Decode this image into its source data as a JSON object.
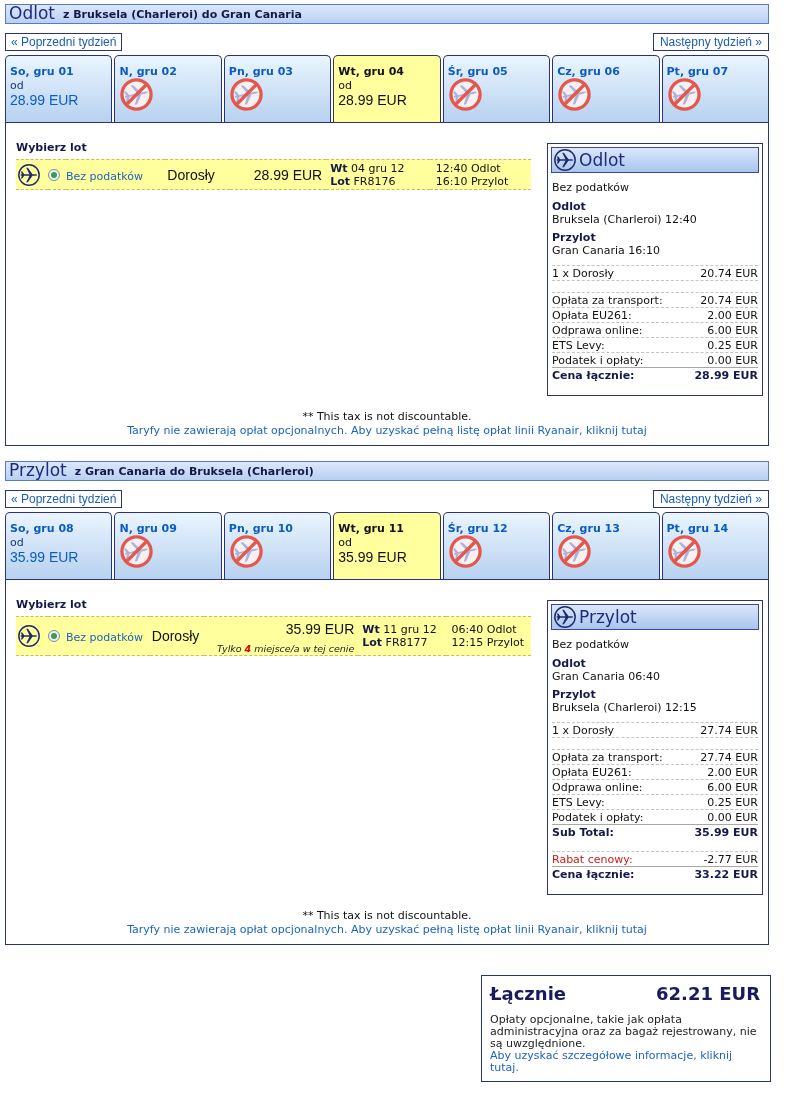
{
  "sections": [
    {
      "title": "Odlot",
      "route": "z Bruksela (Charleroi) do Gran Canaria",
      "prev_week": "« Poprzedni tydzień",
      "next_week": "Następny tydzień »",
      "days": [
        {
          "label": "So, gru 01",
          "kind": "fare",
          "selected": false,
          "from": "od",
          "price": "28.99 EUR"
        },
        {
          "label": "N, gru 02",
          "kind": "no_flights",
          "selected": false
        },
        {
          "label": "Pn, gru 03",
          "kind": "no_flights",
          "selected": false
        },
        {
          "label": "Wt, gru 04",
          "kind": "fare",
          "selected": true,
          "from": "od",
          "price": "28.99 EUR"
        },
        {
          "label": "Śr, gru 05",
          "kind": "no_flights",
          "selected": false
        },
        {
          "label": "Cz, gru 06",
          "kind": "no_flights",
          "selected": false
        },
        {
          "label": "Pt, gru 07",
          "kind": "no_flights",
          "selected": false
        }
      ],
      "choose_label": "Wybierz lot",
      "flights": [
        {
          "selected": true,
          "fare": "Bez podatków",
          "passenger": "Dorosły",
          "price": "28.99 EUR",
          "date": "**Wt** 04 gru 12",
          "flight_no": "**Lot** FR8176",
          "departure": "12:40 Odlot",
          "arrival": "16:10 Przylot"
        }
      ],
      "summary": {
        "title": "Odlot",
        "fare": "Bez podatków",
        "departure_label": "Odlot",
        "departure": "Bruksela (Charleroi) 12:40",
        "arrival_label": "Przylot",
        "arrival": "Gran Canaria 16:10",
        "price_groups": [
          [
            {
              "kind": "item",
              "label": "1 x Dorosły",
              "value": "20.74 EUR"
            }
          ],
          [
            {
              "kind": "item",
              "label": "Opłata za transport:",
              "value": "20.74 EUR"
            },
            {
              "kind": "item",
              "label": "Opłata EU261:",
              "value": "2.00 EUR"
            },
            {
              "kind": "item",
              "label": "Odprawa online:",
              "value": "6.00 EUR"
            },
            {
              "kind": "item",
              "label": "ETS Levy:",
              "value": "0.25 EUR"
            },
            {
              "kind": "item",
              "label": "Podatek i opłaty:",
              "value": "0.00 EUR"
            },
            {
              "kind": "total",
              "label": "Cena łącznie:",
              "value": "28.99 EUR"
            }
          ]
        ]
      },
      "footnote": "** This tax is not discountable.",
      "fares_link": "Taryfy nie zawierają opłat opcjonalnych. Aby uzyskać pełną listę opłat linii Ryanair, kliknij tutaj"
    },
    {
      "title": "Przylot",
      "route": "z Gran Canaria do Bruksela (Charleroi)",
      "prev_week": "« Poprzedni tydzień",
      "next_week": "Następny tydzień »",
      "days": [
        {
          "label": "So, gru 08",
          "kind": "fare",
          "selected": false,
          "from": "od",
          "price": "35.99 EUR"
        },
        {
          "label": "N, gru 09",
          "kind": "no_flights",
          "selected": false
        },
        {
          "label": "Pn, gru 10",
          "kind": "no_flights",
          "selected": false
        },
        {
          "label": "Wt, gru 11",
          "kind": "fare",
          "selected": true,
          "from": "od",
          "price": "35.99 EUR"
        },
        {
          "label": "Śr, gru 12",
          "kind": "no_flights",
          "selected": false
        },
        {
          "label": "Cz, gru 13",
          "kind": "no_flights",
          "selected": false
        },
        {
          "label": "Pt, gru 14",
          "kind": "no_flights",
          "selected": false
        }
      ],
      "choose_label": "Wybierz lot",
      "flights": [
        {
          "selected": true,
          "fare": "Bez podatków",
          "passenger": "Dorosły",
          "price": "35.99 EUR",
          "note": "Tylko **4** miejsce/a w tej cenie",
          "date": "**Wt** 11 gru 12",
          "flight_no": "**Lot** FR8177",
          "departure": "06:40 Odlot",
          "arrival": "12:15 Przylot"
        }
      ],
      "summary": {
        "title": "Przylot",
        "fare": "Bez podatków",
        "departure_label": "Odlot",
        "departure": "Gran Canaria 06:40",
        "arrival_label": "Przylot",
        "arrival": "Bruksela (Charleroi) 12:15",
        "price_groups": [
          [
            {
              "kind": "item",
              "label": "1 x Dorosły",
              "value": "27.74 EUR"
            }
          ],
          [
            {
              "kind": "item",
              "label": "Opłata za transport:",
              "value": "27.74 EUR"
            },
            {
              "kind": "item",
              "label": "Opłata EU261:",
              "value": "2.00 EUR"
            },
            {
              "kind": "item",
              "label": "Odprawa online:",
              "value": "6.00 EUR"
            },
            {
              "kind": "item",
              "label": "ETS Levy:",
              "value": "0.25 EUR"
            },
            {
              "kind": "item",
              "label": "Podatek i opłaty:",
              "value": "0.00 EUR"
            },
            {
              "kind": "subtotal",
              "label": "Sub Total:",
              "value": "35.99 EUR"
            }
          ],
          [
            {
              "kind": "discount",
              "label": "Rabat cenowy:",
              "value": "-2.77 EUR"
            },
            {
              "kind": "total",
              "label": "Cena łącznie:",
              "value": "33.22 EUR"
            }
          ]
        ]
      },
      "footnote": "** This tax is not discountable.",
      "fares_link": "Taryfy nie zawierają opłat opcjonalnych. Aby uzyskać pełną listę opłat linii Ryanair, kliknij tutaj"
    }
  ],
  "total": {
    "label": "Łącznie",
    "amount": "62.21 EUR",
    "note": "Opłaty opcjonalne, takie jak opłata administracyjna oraz za bagaż rejestrowany, nie są uwzględnione.",
    "link": "Aby uzyskać szczegółowe informacje, kliknij tutaj."
  }
}
